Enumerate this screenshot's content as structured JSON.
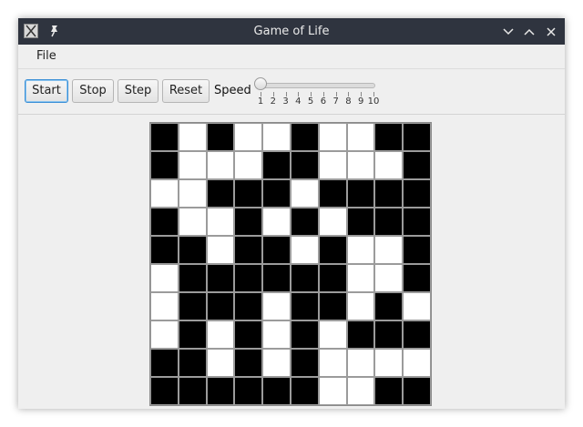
{
  "window": {
    "title": "Game of Life"
  },
  "menubar": {
    "items": [
      "File"
    ]
  },
  "toolbar": {
    "buttons": [
      "Start",
      "Stop",
      "Step",
      "Reset"
    ],
    "speed_label": "Speed",
    "speed": {
      "value": 1,
      "min": 1,
      "max": 10,
      "tick_labels": [
        "1",
        "2",
        "3",
        "4",
        "5",
        "6",
        "7",
        "8",
        "9",
        "10"
      ]
    }
  },
  "board": {
    "rows": 10,
    "cols": 10,
    "cells": [
      [
        1,
        0,
        1,
        0,
        0,
        1,
        0,
        0,
        1,
        1
      ],
      [
        1,
        0,
        0,
        0,
        1,
        1,
        0,
        0,
        0,
        1
      ],
      [
        0,
        0,
        1,
        1,
        1,
        0,
        1,
        1,
        1,
        1
      ],
      [
        1,
        0,
        0,
        1,
        0,
        1,
        0,
        1,
        1,
        1
      ],
      [
        1,
        1,
        0,
        1,
        1,
        0,
        1,
        0,
        0,
        1
      ],
      [
        0,
        1,
        1,
        1,
        1,
        1,
        1,
        0,
        0,
        1
      ],
      [
        0,
        1,
        1,
        1,
        0,
        1,
        1,
        0,
        1,
        0
      ],
      [
        0,
        1,
        0,
        1,
        0,
        1,
        0,
        1,
        1,
        1
      ],
      [
        1,
        1,
        0,
        1,
        0,
        1,
        0,
        0,
        0,
        0
      ],
      [
        1,
        1,
        1,
        1,
        1,
        1,
        0,
        0,
        1,
        1
      ]
    ]
  }
}
